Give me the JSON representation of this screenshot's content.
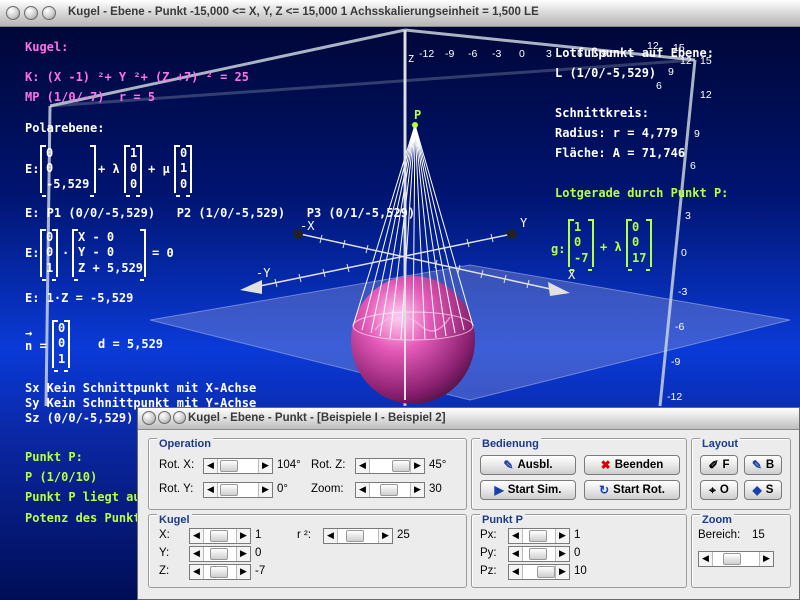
{
  "main_window": {
    "title": "Kugel - Ebene - Punkt   -15,000 <= X, Y, Z <= 15,000    1 Achsskalierungseinheit = 1,500 LE"
  },
  "left_panel": {
    "kugel_heading": "Kugel:",
    "kugel_equation": "K: (X -1) ²+ Y ²+ (Z +7) ² = 25",
    "kugel_mp": "MP (1/0/-7)  r = 5",
    "polarebene_heading": "Polarebene:",
    "plane_param": {
      "prefix": "E:",
      "v0": "0\n0\n-5,529",
      "plus_lambda": "+ λ",
      "v1": "1\n0\n0",
      "plus_mu": "+ μ",
      "v2": "0\n1\n0"
    },
    "points_line": "E: P1 (0/0/-5,529)   P2 (1/0/-5,529)   P3 (0/1/-5,529)",
    "normal_form": {
      "prefix": "E:",
      "n": "0\n0\n1",
      "dot": "·",
      "diff": "X - 0\nY - 0\nZ + 5,529",
      "equals": "= 0"
    },
    "coord_form": "E: 1·Z = -5,529",
    "arrow": "→",
    "normal_vector": {
      "prefix": "n =",
      "n": "0\n0\n1",
      "d": "d = 5,529"
    },
    "sx": "Sx Kein Schnittpunkt mit X-Achse",
    "sy": "Sy Kein Schnittpunkt mit Y-Achse",
    "sz": "Sz (0/0/-5,529)",
    "punkt_heading": "Punkt P:",
    "punkt_value": "P (1/0/10)",
    "punkt_liegt": "Punkt P liegt außerhalb der Kugel",
    "potenz": "Potenz des Punktes"
  },
  "right_panel": {
    "lotfuss_heading": "Lotfußpunkt auf Ebene:",
    "lotfuss_value": "L (1/0/-5,529)",
    "schnittkreis_heading": "Schnittkreis:",
    "radius": "Radius: r = 4,779",
    "flaeche": "Fläche: A = 71,746",
    "lotgerade_heading": "Lotgerade durch Punkt P:",
    "lotgerade": {
      "prefix": "g:",
      "v0": "1\n0\n-7",
      "plus_lambda": "+ λ",
      "v1": "0\n0\n17"
    }
  },
  "scene": {
    "label_p": "P",
    "label_x_neg": "-X",
    "label_x": "X",
    "label_y": "Y",
    "label_y_neg": "-Y",
    "label_z": "Z",
    "top_scale": [
      "-12",
      "-9",
      "-6",
      "-3",
      "0",
      "3",
      "6",
      "9",
      "12",
      "15"
    ],
    "right_scale_a": [
      "15",
      "12",
      "9",
      "6"
    ],
    "right_scale_b": [
      "3",
      "0",
      "-3",
      "-6",
      "-9",
      "-12"
    ],
    "right_scale_mid": [
      "12",
      "9",
      "6"
    ],
    "colors": {
      "sphere": "#ff6fd0",
      "cone": "#ffffff",
      "plane": "#9aa3d8",
      "axes": "#e0e0e0",
      "box": "#c8d2dc"
    }
  },
  "control_window": {
    "title": "Kugel - Ebene - Punkt - [Beispiele I - Beispiel 2]",
    "operation": {
      "title": "Operation",
      "rot_x_label": "Rot. X:",
      "rot_x_value": "104°",
      "rot_z_label": "Rot. Z:",
      "rot_z_value": "45°",
      "rot_y_label": "Rot. Y:",
      "rot_y_value": "0°",
      "zoom_label": "Zoom:",
      "zoom_value": "30"
    },
    "bedienung": {
      "title": "Bedienung",
      "ausbl": "Ausbl.",
      "beenden": "Beenden",
      "start_sim": "Start Sim.",
      "start_rot": "Start Rot."
    },
    "layout": {
      "title": "Layout",
      "f": "F",
      "b": "B",
      "o": "O",
      "s": "S"
    },
    "kugel": {
      "title": "Kugel",
      "x_label": "X:",
      "x_value": "1",
      "y_label": "Y:",
      "y_value": "0",
      "z_label": "Z:",
      "z_value": "-7",
      "r2_label": "r ²:",
      "r2_value": "25"
    },
    "punkt_p": {
      "title": "Punkt P",
      "px_label": "Px:",
      "px_value": "1",
      "py_label": "Py:",
      "py_value": "0",
      "pz_label": "Pz:",
      "pz_value": "10"
    },
    "zoom": {
      "title": "Zoom",
      "bereich_label": "Bereich:",
      "bereich_value": "15"
    }
  }
}
